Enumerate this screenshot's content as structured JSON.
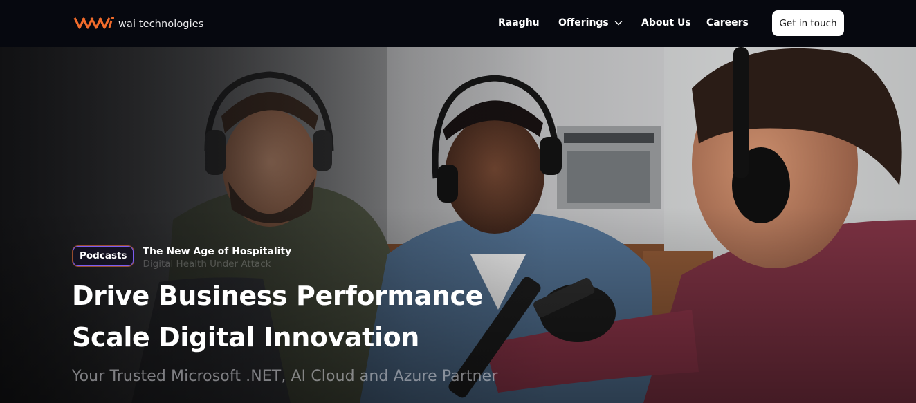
{
  "brand": {
    "logo_text": "wai technologies",
    "accent": "#f26b2b"
  },
  "nav": {
    "items": [
      {
        "label": "Raaghu"
      },
      {
        "label": "Offerings"
      },
      {
        "label": "About Us"
      },
      {
        "label": "Careers"
      }
    ],
    "cta_label": "Get in touch"
  },
  "hero": {
    "badge": "Podcasts",
    "ticker_current": "The New Age of Hospitality",
    "ticker_next": "Digital Health Under Attack",
    "headline_line1": "Drive Business Performance",
    "headline_line2": "Scale Digital Innovation",
    "subheadline": "Your Trusted Microsoft .NET, AI Cloud and Azure Partner"
  }
}
